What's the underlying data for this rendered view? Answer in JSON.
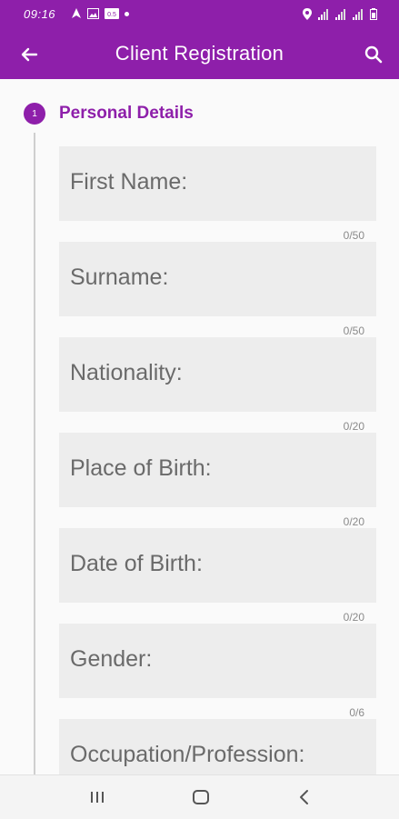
{
  "status_bar": {
    "time": "09:16",
    "left_icons": [
      "navigation-arrow-icon",
      "image-icon",
      "gallery-icon",
      "dot-icon"
    ],
    "right_icons": [
      "location-icon",
      "signal-icon",
      "signal-icon",
      "signal-icon",
      "battery-icon"
    ]
  },
  "app_bar": {
    "title": "Client Registration",
    "color": "#8e1faa"
  },
  "step": {
    "number": "1",
    "title": "Personal Details"
  },
  "fields": [
    {
      "label": "First Name:",
      "counter": "0/50"
    },
    {
      "label": "Surname:",
      "counter": "0/50"
    },
    {
      "label": "Nationality:",
      "counter": "0/20"
    },
    {
      "label": "Place of Birth:",
      "counter": "0/20"
    },
    {
      "label": "Date of Birth:",
      "counter": "0/20"
    },
    {
      "label": "Gender:",
      "counter": "0/6"
    },
    {
      "label": "Occupation/Profession:"
    }
  ],
  "nav_bar": {
    "icons": [
      "recent-apps-icon",
      "home-icon",
      "back-icon"
    ]
  }
}
